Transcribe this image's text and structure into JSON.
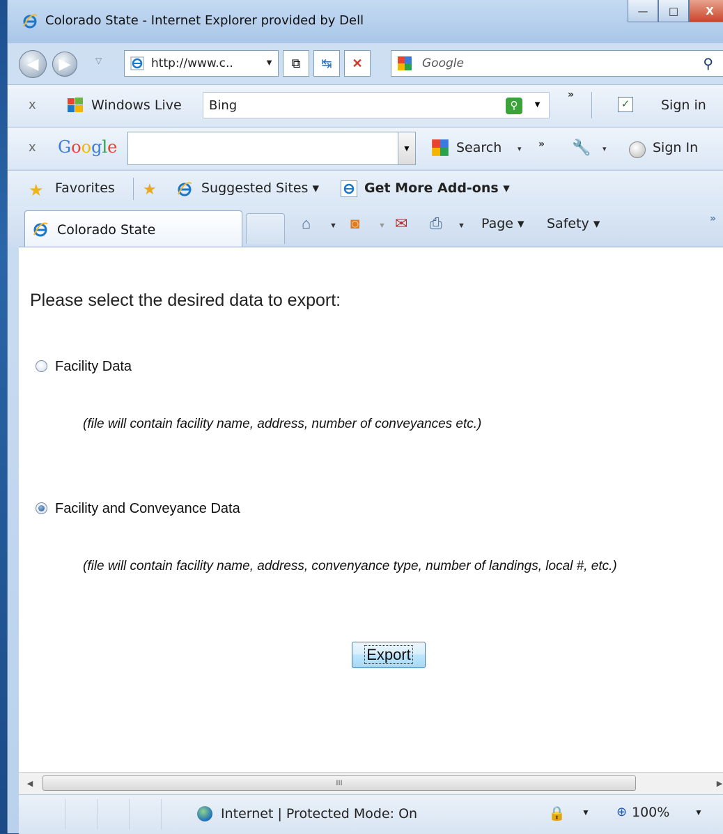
{
  "window": {
    "title": "Colorado State - Internet Explorer provided by Dell",
    "buttons": {
      "minimize": "—",
      "maximize": "□",
      "close": "X"
    }
  },
  "address_bar": {
    "url": "http://www.c..",
    "search_placeholder": "Google"
  },
  "windows_live_bar": {
    "close": "x",
    "brand": "Windows Live",
    "search_value": "Bing",
    "sign_in": "Sign in"
  },
  "google_bar": {
    "close": "x",
    "logo": "Google",
    "search_value": "",
    "search_label": "Search",
    "sign_in": "Sign In"
  },
  "favorites_bar": {
    "favorites": "Favorites",
    "suggested_sites": "Suggested Sites ▾",
    "get_addons": "Get More Add-ons ▾"
  },
  "tabs": {
    "active_tab": "Colorado State"
  },
  "command_bar": {
    "page": "Page ▾",
    "safety": "Safety ▾"
  },
  "page": {
    "prompt": "Please select the desired data to export:",
    "options": [
      {
        "label": "Facility Data",
        "note": "(file will contain facility name, address, number of conveyances etc.)",
        "selected": false
      },
      {
        "label": "Facility and Conveyance Data",
        "note": "(file will contain facility name, address, convenyance type, number of landings, local #, etc.)",
        "selected": true
      }
    ],
    "export_button": "Export"
  },
  "scrollbar": {
    "grip": "III"
  },
  "status_bar": {
    "zone": "Internet | Protected Mode: On",
    "zoom": "100%"
  },
  "colors": {
    "accent": "#1d4f8f",
    "button_border": "#3c7fb1"
  }
}
